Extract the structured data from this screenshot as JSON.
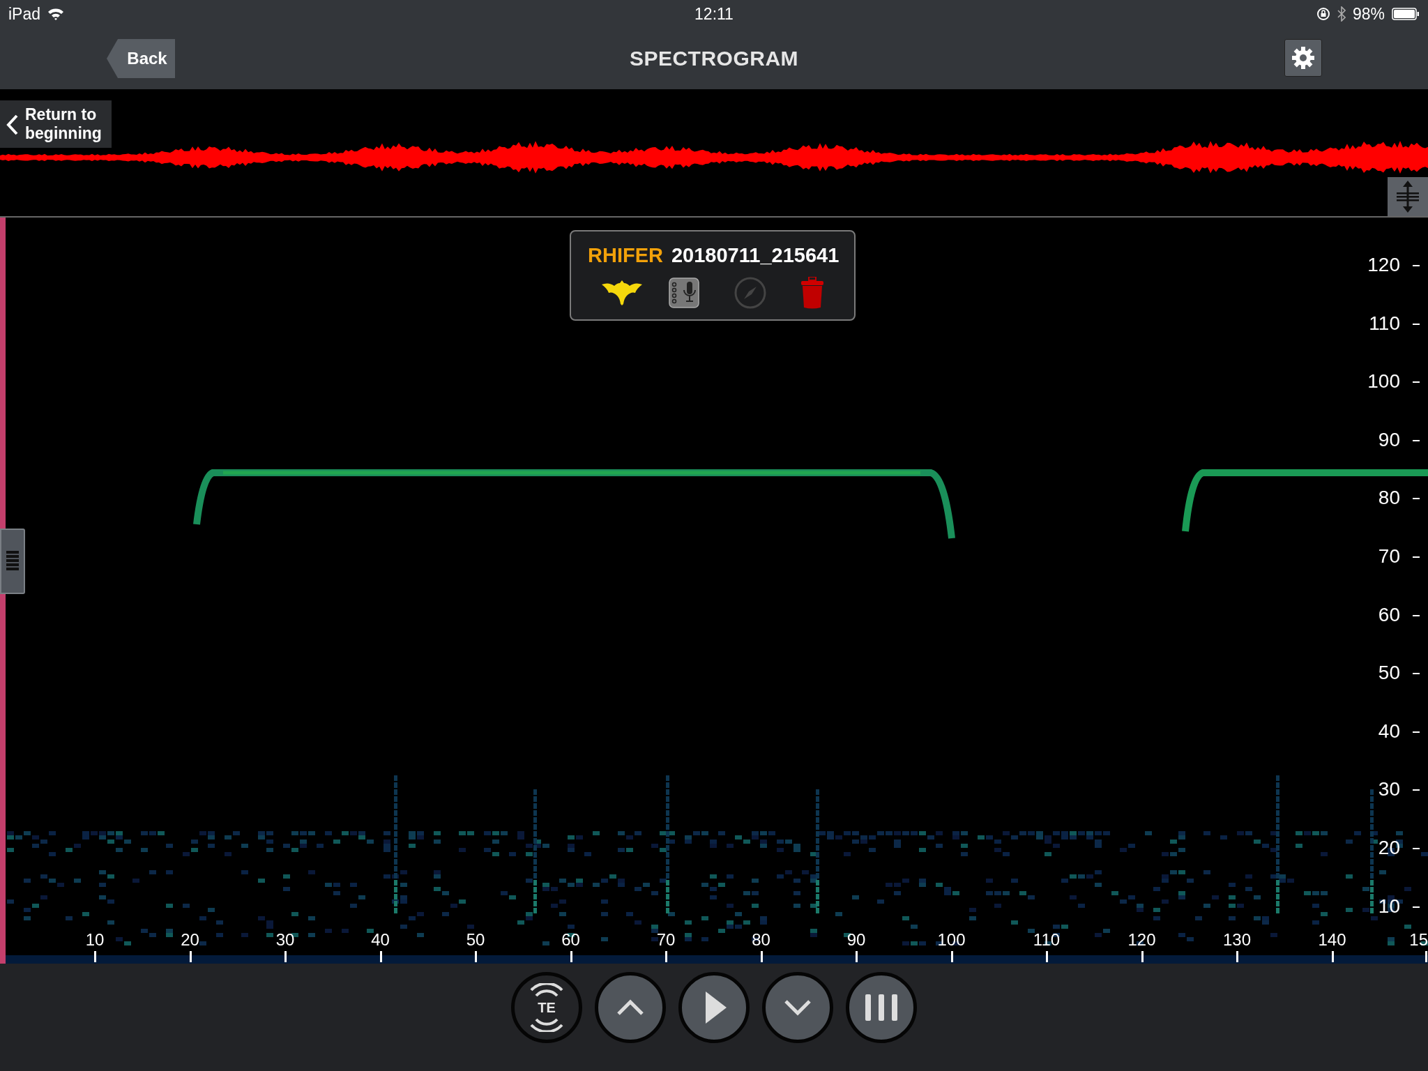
{
  "status_bar": {
    "device": "iPad",
    "time": "12:11",
    "battery": "98%"
  },
  "header": {
    "back": "Back",
    "title": "SPECTROGRAM"
  },
  "waveform": {
    "return_button": "Return to beginning"
  },
  "recording_card": {
    "species": "RHIFER",
    "file": "20180711_215641"
  },
  "spectrogram": {
    "frequency_labels": [
      "120",
      "110",
      "100",
      "90",
      "80",
      "70",
      "60",
      "50",
      "40",
      "30",
      "20",
      "10"
    ],
    "time_labels": [
      "10",
      "20",
      "30",
      "40",
      "50",
      "60",
      "70",
      "80",
      "90",
      "100",
      "110",
      "120",
      "130",
      "140",
      "15"
    ]
  },
  "controls": [
    {
      "kind": "te",
      "label": "TE"
    },
    {
      "kind": "up"
    },
    {
      "kind": "play"
    },
    {
      "kind": "down"
    },
    {
      "kind": "bars"
    }
  ]
}
